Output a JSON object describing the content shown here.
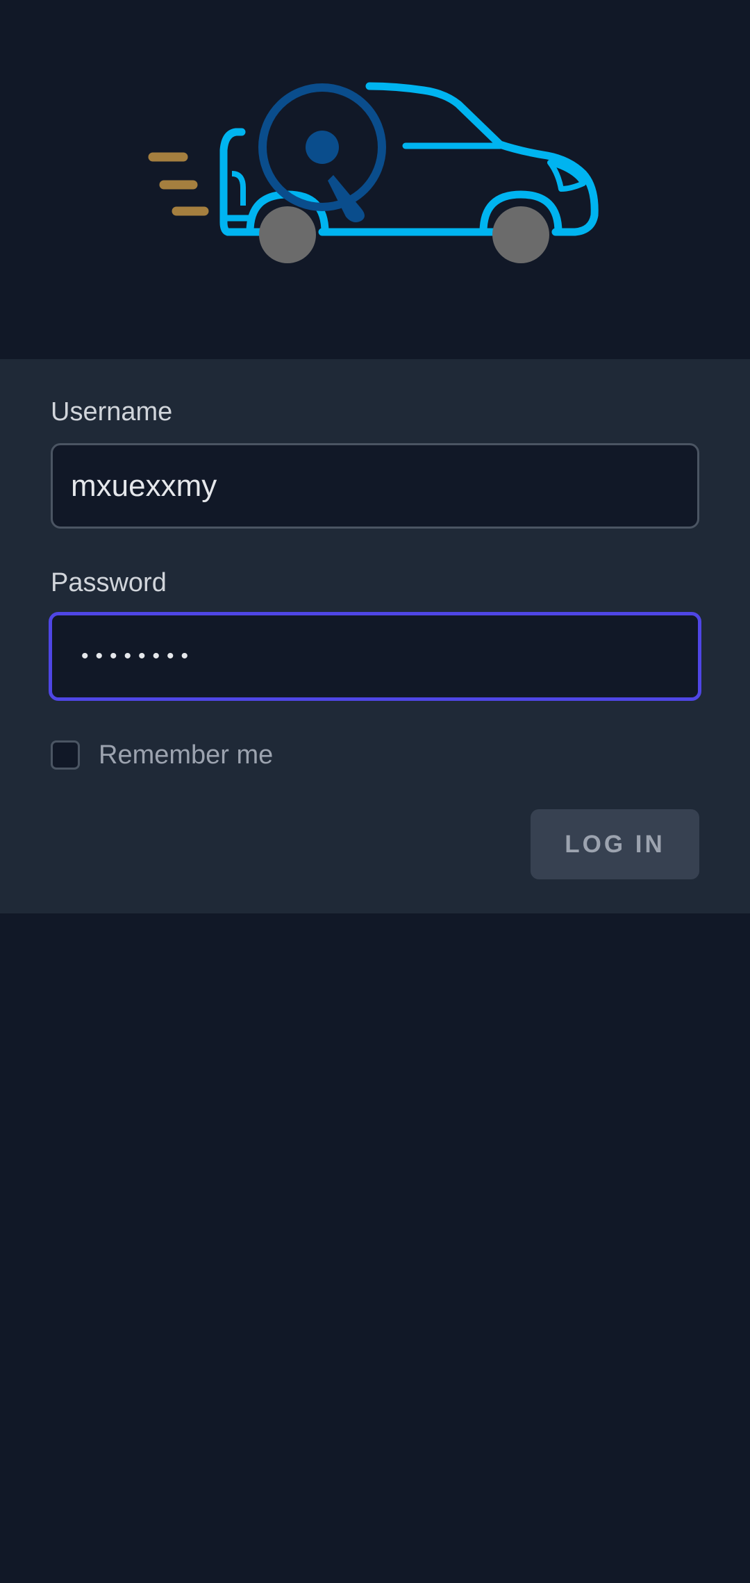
{
  "logo": {
    "icon": "car-speed-logo",
    "colors": {
      "body": "#00b4f0",
      "gauge": "#0a4d8c",
      "wheels": "#6b6b6b",
      "speed_lines": "#a57f3f"
    }
  },
  "form": {
    "username_label": "Username",
    "username_value": "mxuexxmy",
    "password_label": "Password",
    "password_value": "••••••••",
    "remember_label": "Remember me",
    "remember_checked": false,
    "login_button_label": "LOG IN"
  },
  "colors": {
    "background": "#111827",
    "panel": "#1f2937",
    "focus_ring": "#4f46e5",
    "button_bg": "#374151"
  }
}
